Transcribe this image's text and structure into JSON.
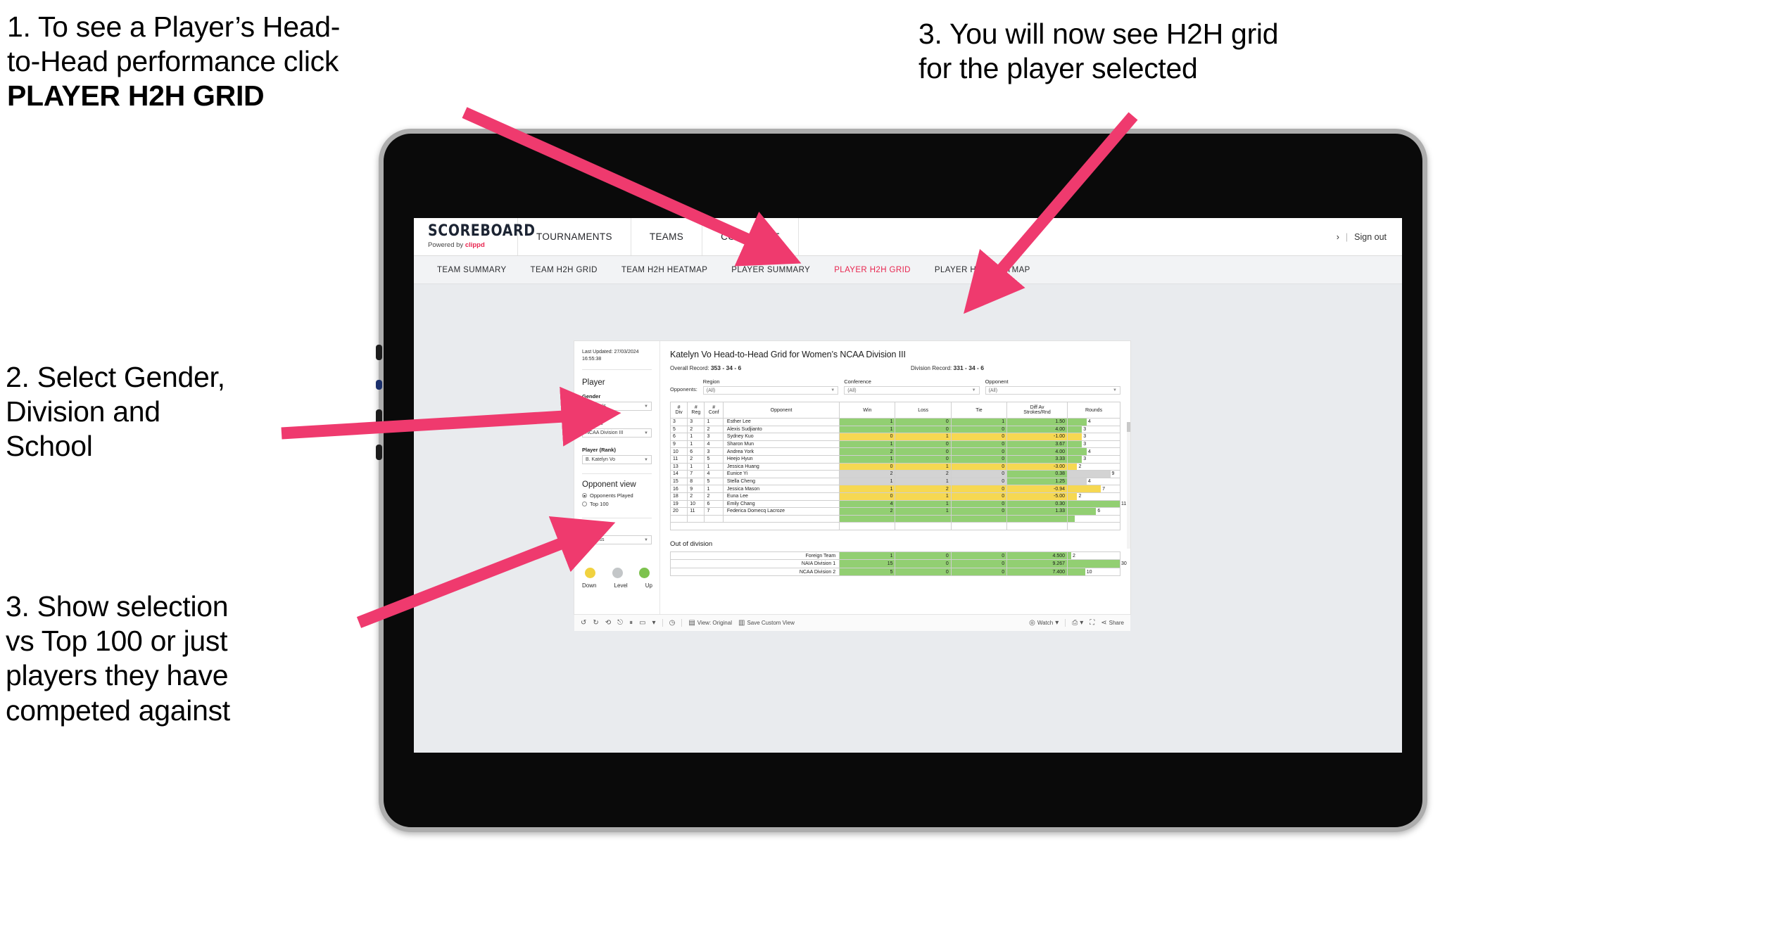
{
  "annotations": [
    {
      "id": "a1",
      "lines": [
        "1. To see a Player’s Head-",
        "to-Head performance click"
      ],
      "strong": "PLAYER H2H GRID"
    },
    {
      "id": "a2",
      "lines": [
        "3. You will now see H2H grid",
        "for the player selected"
      ],
      "strong": ""
    },
    {
      "id": "a3",
      "lines": [
        "2. Select Gender,",
        "Division and",
        "School"
      ],
      "strong": ""
    },
    {
      "id": "a4",
      "lines": [
        "3. Show selection",
        "vs Top 100 or just",
        "players they have",
        "competed against"
      ],
      "strong": ""
    }
  ],
  "app": {
    "logo_main": "SCOREBOARD",
    "logo_sub_prefix": "Powered by ",
    "logo_sub_brand": "clippd",
    "main_nav": [
      "TOURNAMENTS",
      "TEAMS",
      "COMMITTEE"
    ],
    "account_caret": "›",
    "account_sep": "|",
    "sign_out": "Sign out",
    "sub_nav": [
      {
        "label": "TEAM SUMMARY",
        "active": false
      },
      {
        "label": "TEAM H2H GRID",
        "active": false
      },
      {
        "label": "TEAM H2H HEATMAP",
        "active": false
      },
      {
        "label": "PLAYER SUMMARY",
        "active": false
      },
      {
        "label": "PLAYER H2H GRID",
        "active": true
      },
      {
        "label": "PLAYER H2H HEATMAP",
        "active": false
      }
    ],
    "accent_color": "#e8254f"
  },
  "panel": {
    "last_updated": "Last Updated: 27/03/2024 16:55:38",
    "player_heading": "Player",
    "fields": [
      {
        "label": "Gender",
        "value": "Women's"
      },
      {
        "label": "Division",
        "value": "NCAA Division III"
      },
      {
        "label": "Player (Rank)",
        "value": "B. Katelyn Vo"
      }
    ],
    "opponent_view_heading": "Opponent view",
    "opponent_view_options": [
      {
        "label": "Opponents Played",
        "selected": true
      },
      {
        "label": "Top 100",
        "selected": false
      }
    ],
    "colour_by_label": "Colour by",
    "colour_by_value": "Win/loss",
    "legend": [
      {
        "label": "Down",
        "color": "#f1d23f"
      },
      {
        "label": "Level",
        "color": "#c3c6c8"
      },
      {
        "label": "Up",
        "color": "#7dc24e"
      }
    ]
  },
  "viz": {
    "title": "Katelyn Vo Head-to-Head Grid for Women’s NCAA Division III",
    "overall_record_label": "Overall Record:",
    "overall_record_value": "353 -  34 - 6",
    "division_record_label": "Division Record:",
    "division_record_value": "331 -  34 - 6",
    "opponents_label": "Opponents:",
    "filters": [
      {
        "label": "Region",
        "value": "(All)"
      },
      {
        "label": "Conference",
        "value": "(All)"
      },
      {
        "label": "Opponent",
        "value": "(All)"
      }
    ]
  },
  "chart_data": {
    "type": "table",
    "title": "Katelyn Vo Head-to-Head Grid for Women’s NCAA Division III",
    "columns": [
      "# Div",
      "# Reg",
      "# Conf",
      "Opponent",
      "Win",
      "Loss",
      "Tie",
      "Diff Av Strokes/Rnd",
      "Rounds"
    ],
    "column_header_lines": [
      [
        "#",
        "Div"
      ],
      [
        "#",
        "Reg"
      ],
      [
        "#",
        "Conf"
      ],
      [
        "Opponent"
      ],
      [
        "Win"
      ],
      [
        "Loss"
      ],
      [
        "Tie"
      ],
      [
        "Diff Av",
        "Strokes/Rnd"
      ],
      [
        "Rounds"
      ]
    ],
    "rounds_max": 11,
    "rows": [
      {
        "div": "3",
        "reg": "3",
        "conf": "1",
        "opponent": "Esther Lee",
        "win": "1",
        "loss": "0",
        "tie": "1",
        "diff": "1.50",
        "rounds": "4",
        "state": "up"
      },
      {
        "div": "5",
        "reg": "2",
        "conf": "2",
        "opponent": "Alexis Sudjianto",
        "win": "1",
        "loss": "0",
        "tie": "0",
        "diff": "4.00",
        "rounds": "3",
        "state": "up"
      },
      {
        "div": "6",
        "reg": "1",
        "conf": "3",
        "opponent": "Sydney Kuo",
        "win": "0",
        "loss": "1",
        "tie": "0",
        "diff": "-1.00",
        "rounds": "3",
        "state": "down"
      },
      {
        "div": "9",
        "reg": "1",
        "conf": "4",
        "opponent": "Sharon Mun",
        "win": "1",
        "loss": "0",
        "tie": "0",
        "diff": "3.67",
        "rounds": "3",
        "state": "up"
      },
      {
        "div": "10",
        "reg": "6",
        "conf": "3",
        "opponent": "Andrea York",
        "win": "2",
        "loss": "0",
        "tie": "0",
        "diff": "4.00",
        "rounds": "4",
        "state": "up"
      },
      {
        "div": "11",
        "reg": "2",
        "conf": "5",
        "opponent": "Heejo Hyun",
        "win": "1",
        "loss": "0",
        "tie": "0",
        "diff": "3.33",
        "rounds": "3",
        "state": "up"
      },
      {
        "div": "13",
        "reg": "1",
        "conf": "1",
        "opponent": "Jessica Huang",
        "win": "0",
        "loss": "1",
        "tie": "0",
        "diff": "-3.00",
        "rounds": "2",
        "state": "down"
      },
      {
        "div": "14",
        "reg": "7",
        "conf": "4",
        "opponent": "Eunice Yi",
        "win": "2",
        "loss": "2",
        "tie": "0",
        "diff": "0.38",
        "rounds": "9",
        "state": "level-up"
      },
      {
        "div": "15",
        "reg": "8",
        "conf": "5",
        "opponent": "Stella Cheng",
        "win": "1",
        "loss": "1",
        "tie": "0",
        "diff": "1.25",
        "rounds": "4",
        "state": "level-up"
      },
      {
        "div": "16",
        "reg": "9",
        "conf": "1",
        "opponent": "Jessica Mason",
        "win": "1",
        "loss": "2",
        "tie": "0",
        "diff": "-0.94",
        "rounds": "7",
        "state": "down"
      },
      {
        "div": "18",
        "reg": "2",
        "conf": "2",
        "opponent": "Euna Lee",
        "win": "0",
        "loss": "1",
        "tie": "0",
        "diff": "-5.00",
        "rounds": "2",
        "state": "down"
      },
      {
        "div": "19",
        "reg": "10",
        "conf": "6",
        "opponent": "Emily Chang",
        "win": "4",
        "loss": "1",
        "tie": "0",
        "diff": "0.30",
        "rounds": "11",
        "state": "up"
      },
      {
        "div": "20",
        "reg": "11",
        "conf": "7",
        "opponent": "Federica Domecq Lacroze",
        "win": "2",
        "loss": "1",
        "tie": "0",
        "diff": "1.33",
        "rounds": "6",
        "state": "up"
      }
    ],
    "out_of_division_title": "Out of division",
    "out_of_division_rounds_max": 30,
    "out_of_division": [
      {
        "label": "Foreign Team",
        "win": "1",
        "loss": "0",
        "tie": "0",
        "diff": "4.500",
        "rounds": "2",
        "state": "up"
      },
      {
        "label": "NAIA Division 1",
        "win": "15",
        "loss": "0",
        "tie": "0",
        "diff": "9.267",
        "rounds": "30",
        "state": "up"
      },
      {
        "label": "NCAA Division 2",
        "win": "5",
        "loss": "0",
        "tie": "0",
        "diff": "7.400",
        "rounds": "10",
        "state": "up"
      }
    ]
  },
  "toolbar": {
    "view_original": "View: Original",
    "save_custom_view": "Save Custom View",
    "watch": "Watch",
    "share": "Share",
    "caret": "▾"
  }
}
